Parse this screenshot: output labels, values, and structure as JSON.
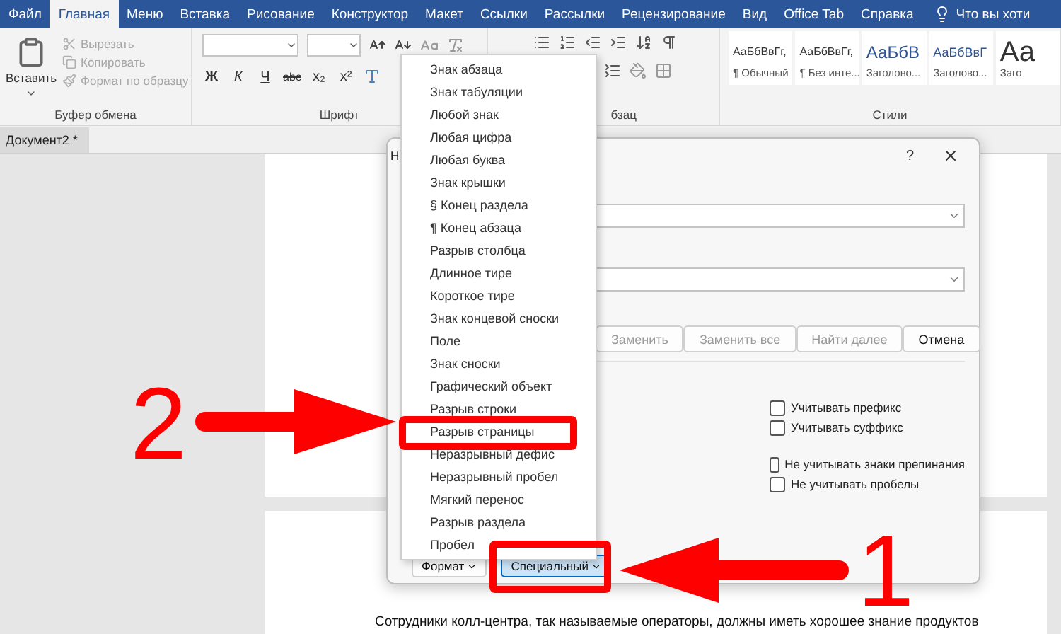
{
  "ribbon_tabs": [
    {
      "label": "Файл",
      "selected": false
    },
    {
      "label": "Главная",
      "selected": true
    },
    {
      "label": "Меню",
      "selected": false
    },
    {
      "label": "Вставка",
      "selected": false
    },
    {
      "label": "Рисование",
      "selected": false
    },
    {
      "label": "Конструктор",
      "selected": false
    },
    {
      "label": "Макет",
      "selected": false
    },
    {
      "label": "Ссылки",
      "selected": false
    },
    {
      "label": "Рассылки",
      "selected": false
    },
    {
      "label": "Рецензирование",
      "selected": false
    },
    {
      "label": "Вид",
      "selected": false
    },
    {
      "label": "Office Tab",
      "selected": false
    },
    {
      "label": "Справка",
      "selected": false
    }
  ],
  "tell_me": "Что вы хоти",
  "clipboard": {
    "paste": "Вставить",
    "label": "Буфер обмена",
    "actions": [
      {
        "label": "Вырезать",
        "disabled": true
      },
      {
        "label": "Копировать",
        "disabled": true
      },
      {
        "label": "Формат по образцу",
        "disabled": true
      }
    ]
  },
  "font": {
    "label": "Шрифт",
    "format_buttons": [
      "Ж",
      "К",
      "Ч",
      "abc",
      "x₂",
      "x²"
    ]
  },
  "paragraph": {
    "label": "бзац"
  },
  "styles": {
    "label": "Стили",
    "items": [
      {
        "kind": "normal",
        "sample": "АаБбВвГг,",
        "name": "¶ Обычный"
      },
      {
        "kind": "normal",
        "sample": "АаБбВвГг,",
        "name": "¶ Без инте..."
      },
      {
        "kind": "heading1",
        "sample": "АаБбВ",
        "name": "Заголово..."
      },
      {
        "kind": "heading2",
        "sample": "АаБбВвГ",
        "name": "Заголово..."
      },
      {
        "kind": "title",
        "sample": "Аа",
        "name": "Заго"
      }
    ]
  },
  "document_tab": {
    "label": "Документ2 *"
  },
  "page_text": "Сотрудники колл-центра, так называемые операторы, должны иметь хорошее знание продуктов",
  "dialog": {
    "title": "Н",
    "help": "?",
    "actions": [
      {
        "label": "Заменить",
        "disabled": true
      },
      {
        "label": "Заменить все",
        "disabled": true
      },
      {
        "label": "Найти далее",
        "disabled": true
      },
      {
        "label": "Отмена",
        "disabled": false
      }
    ],
    "options": [
      {
        "label": "Учитывать префикс",
        "checked": false
      },
      {
        "label": "Учитывать суффикс",
        "checked": false
      },
      {
        "label": "Не учитывать знаки препинания",
        "checked": false
      },
      {
        "label": "Не учитывать пробелы",
        "checked": false
      }
    ],
    "footer_buttons": [
      {
        "label": "Формат",
        "selected": false
      },
      {
        "label": "Специальный",
        "selected": true
      }
    ]
  },
  "special_menu": {
    "items": [
      "Знак абзаца",
      "Знак табуляции",
      "Любой знак",
      "Любая цифра",
      "Любая буква",
      "Знак крышки",
      "§ Конец раздела",
      "¶ Конец абзаца",
      "Разрыв столбца",
      "Длинное тире",
      "Короткое тире",
      "Знак концевой сноски",
      "Поле",
      "Знак сноски",
      "Графический объект",
      "Разрыв строки",
      "Разрыв страницы",
      "Неразрывный дефис",
      "Неразрывный пробел",
      "Мягкий перенос",
      "Разрыв раздела",
      "Пробел"
    ]
  },
  "annotations": [
    {
      "number": "2"
    },
    {
      "number": "1"
    }
  ]
}
